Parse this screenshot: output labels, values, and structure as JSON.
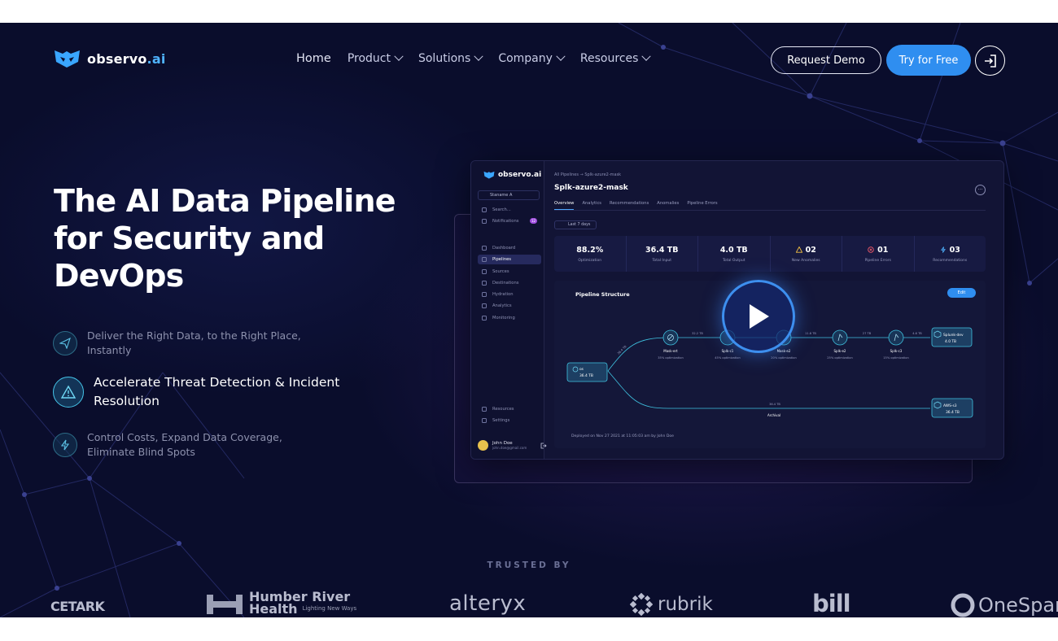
{
  "brand": {
    "logo_text": "observo",
    "logo_suffix": ".ai"
  },
  "nav": {
    "items": [
      {
        "label": "Home"
      },
      {
        "label": "Product"
      },
      {
        "label": "Solutions"
      },
      {
        "label": "Company"
      },
      {
        "label": "Resources"
      }
    ],
    "request_demo": "Request Demo",
    "try_free": "Try for Free"
  },
  "hero": {
    "title": "The AI Data Pipeline for Security and DevOps",
    "features": [
      {
        "text": "Deliver the Right Data, to the Right Place, Instantly",
        "icon": "send-icon"
      },
      {
        "text": "Accelerate Threat Detection & Incident Resolution",
        "icon": "warning-icon"
      },
      {
        "text": "Control Costs, Expand Data Coverage, Eliminate Blind Spots",
        "icon": "lightning-icon"
      }
    ]
  },
  "dashboard": {
    "logo_text": "observo.ai",
    "env": "Staname A",
    "sidebar_top": [
      {
        "label": "Search..."
      },
      {
        "label": "Notifications",
        "badge": "12"
      }
    ],
    "sidebar": [
      {
        "label": "Dashboard"
      },
      {
        "label": "Pipelines"
      },
      {
        "label": "Sources"
      },
      {
        "label": "Destinations"
      },
      {
        "label": "Hydration"
      },
      {
        "label": "Analytics"
      },
      {
        "label": "Monitoring"
      }
    ],
    "sidebar_bottom": [
      {
        "label": "Resources"
      },
      {
        "label": "Settings"
      }
    ],
    "user": {
      "name": "John Doe",
      "email": "john.doe@gmail.com"
    },
    "breadcrumb": "All Pipelines → Splk-azure2-mask",
    "title": "Splk-azure2-mask",
    "tabs": [
      "Overview",
      "Analytics",
      "Recommendations",
      "Anomalies",
      "Pipeline Errors"
    ],
    "date_filter": "Last 7 days",
    "stats": [
      {
        "value": "88.2%",
        "label": "Optimization"
      },
      {
        "value": "36.4 TB",
        "label": "Total Input"
      },
      {
        "value": "4.0 TB",
        "label": "Total Output"
      },
      {
        "value": "02",
        "label": "New Anomalies"
      },
      {
        "value": "01",
        "label": "Pipeline Errors"
      },
      {
        "value": "03",
        "label": "Recommendations"
      }
    ],
    "pipeline_title": "Pipeline Structure",
    "edit_label": "Edit",
    "source": {
      "name": "os",
      "size": "36.4 TB"
    },
    "nodes": [
      {
        "name": "Mask-ert",
        "pct": "35% optimization"
      },
      {
        "name": "Splk-c1",
        "pct": "45% optimization"
      },
      {
        "name": "Mask-e2",
        "pct": "20% optimization"
      },
      {
        "name": "Splk-e2",
        "pct": "25% optimization"
      },
      {
        "name": "Splk-c3",
        "pct": "15% optimization"
      }
    ],
    "edge_labels": [
      "36.4 TB",
      "32.2 TB",
      "11.8 TB",
      "27 TB",
      "4.6 TB",
      "36.4 TB"
    ],
    "dest_top": {
      "name": "Splunk-dev",
      "size": "4.0 TB"
    },
    "dest_bottom": {
      "name": "AWS-s3",
      "size": "36.4 TB"
    },
    "archival": "Archival",
    "deployed": "Deployed on Nov 27 2021 at 11:05:03 am by John Doe"
  },
  "trusted": {
    "label": "TRUSTED BY",
    "logos": [
      "CETARK",
      "Humber River",
      "Health",
      "Lighting New Ways",
      "alteryx",
      "rubrik",
      "bill",
      "OneSpan"
    ]
  },
  "colors": {
    "accent": "#2f8ef0",
    "background": "#0a0d2c",
    "teal": "#45c3e8"
  }
}
